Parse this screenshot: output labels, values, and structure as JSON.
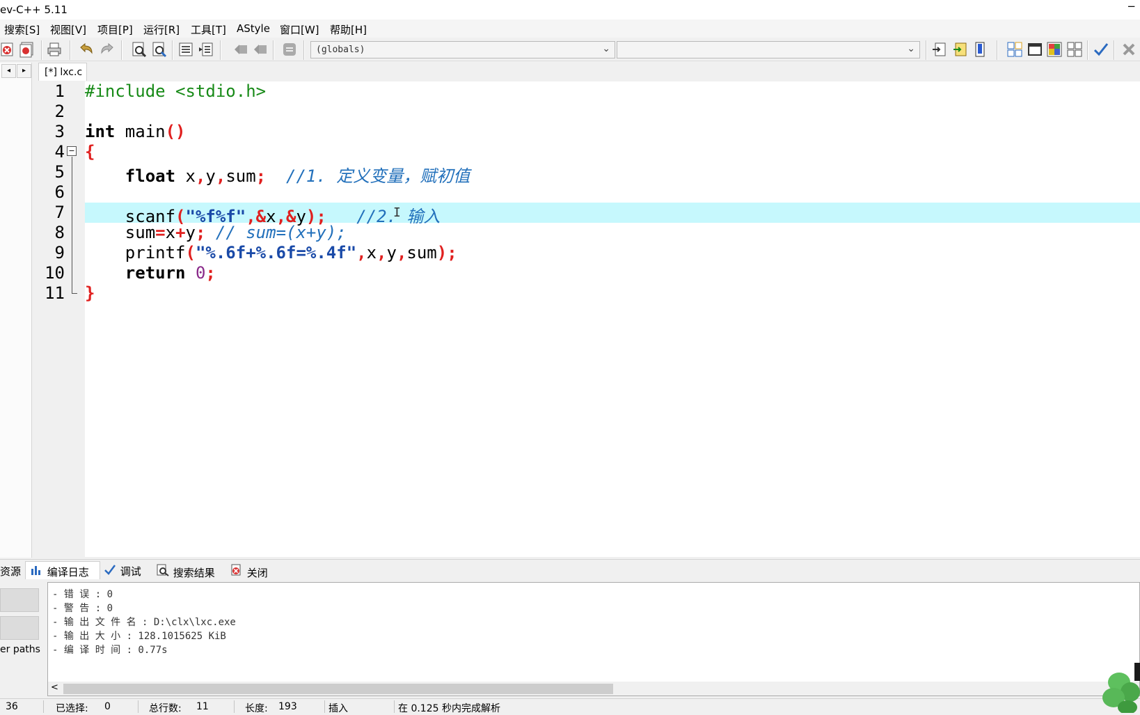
{
  "window": {
    "title": "ev-C++ 5.11",
    "minimize_glyph": "−"
  },
  "menu": [
    "搜索[S]",
    "视图[V]",
    "项目[P]",
    "运行[R]",
    "工具[T]",
    "AStyle",
    "窗口[W]",
    "帮助[H]"
  ],
  "toolbar": {
    "scope_combo": "(globals)",
    "member_combo": ""
  },
  "editor_tab": "[*] lxc.c",
  "code": {
    "line_numbers": [
      "1",
      "2",
      "3",
      "4",
      "5",
      "6",
      "7",
      "8",
      "9",
      "10",
      "11"
    ],
    "active_line": 7
  },
  "bottom_tabs": {
    "resources": "资源",
    "compile_log": "编译日志",
    "debug": "调试",
    "search_results": "搜索结果",
    "close": "关闭"
  },
  "left_panel": {
    "paths_label": "er paths"
  },
  "compile_log": [
    "- 错 误 : 0",
    "- 警 告 : 0",
    "- 输 出 文 件 名 : D:\\clx\\lxc.exe",
    "- 输 出 大 小 : 128.1015625 KiB",
    "- 编 译 时 间 : 0.77s"
  ],
  "status": {
    "col": "36",
    "selected_label": "已选择:",
    "selected_value": "0",
    "lines_label": "总行数:",
    "lines_value": "11",
    "length_label": "长度:",
    "length_value": "193",
    "mode": "插入",
    "parse_msg": "在 0.125 秒内完成解析"
  },
  "colors": {
    "active_line": "#c6f8fd",
    "preprocessor": "#178a17",
    "string": "#1a4aa8",
    "symbol": "#e0201f",
    "comment": "#2270bb"
  }
}
